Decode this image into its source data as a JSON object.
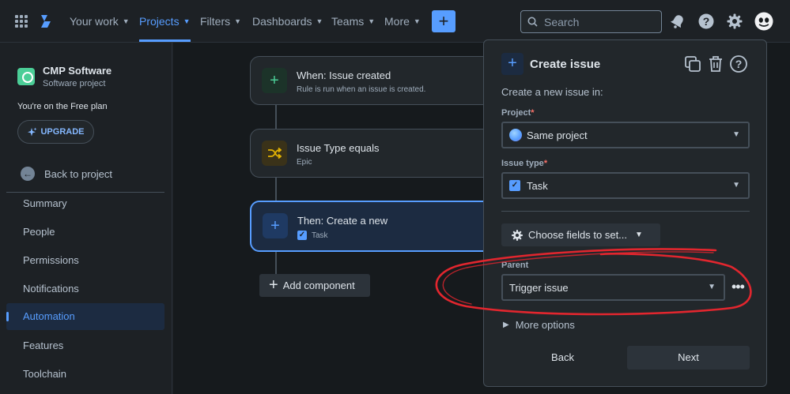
{
  "topnav": {
    "items": [
      {
        "label": "Your work",
        "active": false
      },
      {
        "label": "Projects",
        "active": true
      },
      {
        "label": "Filters",
        "active": false
      },
      {
        "label": "Dashboards",
        "active": false
      },
      {
        "label": "Teams",
        "active": false
      },
      {
        "label": "More",
        "active": false
      }
    ],
    "create_label": "+",
    "search_placeholder": "Search"
  },
  "sidebar": {
    "project_name": "CMP Software",
    "project_type": "Software project",
    "plan_text": "You're on the Free plan",
    "upgrade_label": "UPGRADE",
    "back_label": "Back to project",
    "items": [
      {
        "label": "Summary",
        "active": false
      },
      {
        "label": "People",
        "active": false
      },
      {
        "label": "Permissions",
        "active": false
      },
      {
        "label": "Notifications",
        "active": false
      },
      {
        "label": "Automation",
        "active": true
      },
      {
        "label": "Features",
        "active": false
      },
      {
        "label": "Toolchain",
        "active": false
      }
    ]
  },
  "rule": {
    "trigger": {
      "title": "When: Issue created",
      "subtitle": "Rule is run when an issue is created."
    },
    "condition": {
      "title": "Issue Type equals",
      "subtitle": "Epic"
    },
    "action": {
      "title": "Then: Create a new",
      "subtitle": "Task"
    },
    "add_component_label": "Add component"
  },
  "panel": {
    "title": "Create issue",
    "intro": "Create a new issue in:",
    "project_label": "Project",
    "project_value": "Same project",
    "issue_type_label": "Issue type",
    "issue_type_value": "Task",
    "choose_fields_label": "Choose fields to set...",
    "parent_label": "Parent",
    "parent_value": "Trigger issue",
    "more_options_label": "More options",
    "back_label": "Back",
    "next_label": "Next",
    "required_marker": "*"
  },
  "colors": {
    "accent": "#579dff",
    "annotation": "#e2262e"
  }
}
